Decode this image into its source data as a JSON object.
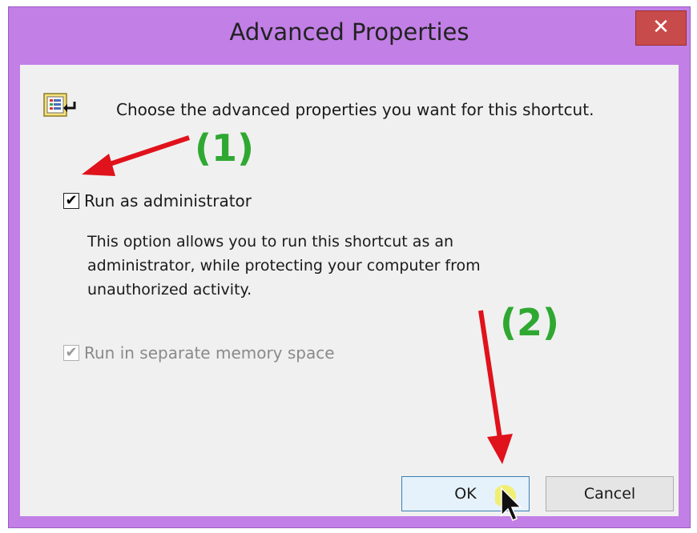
{
  "window": {
    "title": "Advanced Properties",
    "close_glyph": "✕",
    "frame_color": "#c27fe6"
  },
  "content": {
    "heading": "Choose the advanced properties you want for this shortcut.",
    "icon": "shortcut-properties-icon",
    "run_as_admin": {
      "label": "Run as administrator",
      "checked": true,
      "glyph": "✔"
    },
    "description": "This option allows you to run this shortcut as an administrator, while protecting your computer from unauthorized activity.",
    "separate_memory": {
      "label": "Run in separate memory space",
      "checked": true,
      "enabled": false,
      "glyph": "✔"
    }
  },
  "buttons": {
    "ok": "OK",
    "cancel": "Cancel"
  },
  "annotations": {
    "step1": "(1)",
    "step2": "(2)",
    "arrow_color": "#e0121b",
    "label_color": "#2fa832"
  }
}
